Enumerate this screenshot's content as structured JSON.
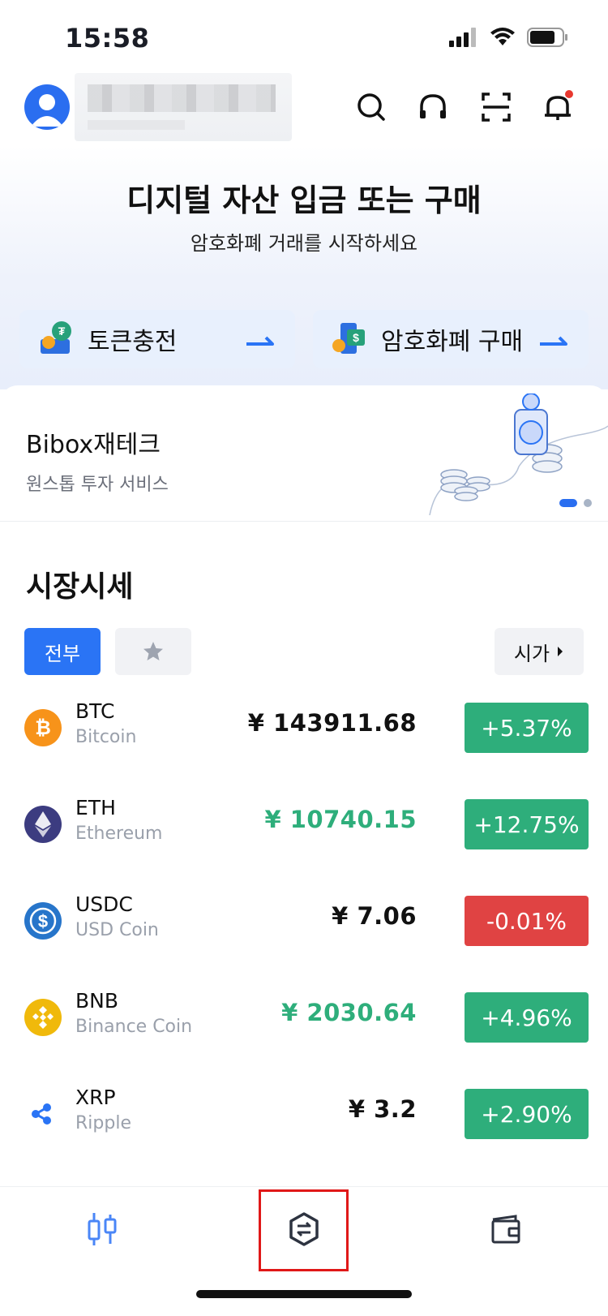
{
  "status_bar": {
    "time": "15:58"
  },
  "hero": {
    "title": "디지털 자산 입금 또는 구매",
    "subtitle": "암호화폐 거래를 시작하세요",
    "actions": [
      {
        "label": "토큰충전",
        "icon": "tether-deposit-icon"
      },
      {
        "label": "암호화폐 구매",
        "icon": "buy-crypto-icon"
      }
    ]
  },
  "banner": {
    "title": "Bibox재테크",
    "subtitle": "원스톱 투자 서비스"
  },
  "market": {
    "title": "시장시세",
    "tabs": {
      "all": "전부"
    },
    "sort_label": "시가",
    "coins": [
      {
        "symbol": "BTC",
        "name": "Bitcoin",
        "price": "¥ 143911.68",
        "change": "+5.37%",
        "price_color": "#111111",
        "change_color": "#2eae7b",
        "icon": "bitcoin-icon"
      },
      {
        "symbol": "ETH",
        "name": "Ethereum",
        "price": "¥ 10740.15",
        "change": "+12.75%",
        "price_color": "#2eae7b",
        "change_color": "#2eae7b",
        "icon": "ethereum-icon"
      },
      {
        "symbol": "USDC",
        "name": "USD Coin",
        "price": "¥ 7.06",
        "change": "-0.01%",
        "price_color": "#111111",
        "change_color": "#e04343",
        "icon": "usdc-icon"
      },
      {
        "symbol": "BNB",
        "name": "Binance Coin",
        "price": "¥ 2030.64",
        "change": "+4.96%",
        "price_color": "#2eae7b",
        "change_color": "#2eae7b",
        "icon": "bnb-icon"
      },
      {
        "symbol": "XRP",
        "name": "Ripple",
        "price": "¥ 3.2",
        "change": "+2.90%",
        "price_color": "#111111",
        "change_color": "#2eae7b",
        "icon": "xrp-icon"
      }
    ]
  },
  "bottom_nav": {
    "items": [
      {
        "icon": "market-chart-icon"
      },
      {
        "icon": "trade-exchange-icon"
      },
      {
        "icon": "wallet-icon"
      }
    ]
  },
  "colors": {
    "accent": "#2a74f5",
    "up": "#2eae7b",
    "down": "#e04343"
  }
}
